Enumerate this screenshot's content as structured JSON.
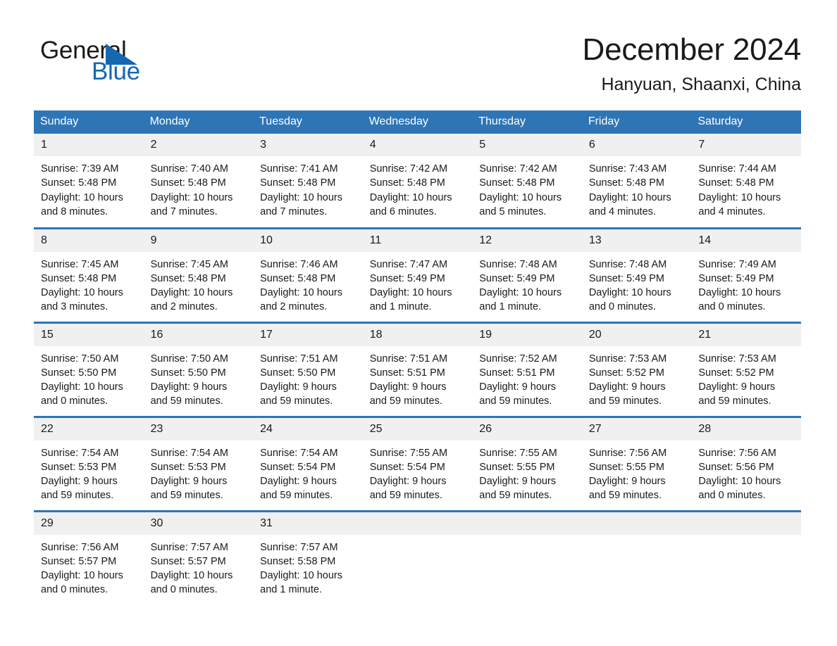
{
  "brand": {
    "name_part1": "General",
    "name_part2": "Blue",
    "accent_color": "#1667b2",
    "triangle_icon": "triangle-icon"
  },
  "header": {
    "title": "December 2024",
    "subtitle": "Hanyuan, Shaanxi, China"
  },
  "theme": {
    "header_blue": "#2e75b6",
    "daynum_band": "#f0f0f0",
    "text": "#1a1a1a"
  },
  "calendar": {
    "weekday_headers": [
      "Sunday",
      "Monday",
      "Tuesday",
      "Wednesday",
      "Thursday",
      "Friday",
      "Saturday"
    ],
    "weeks": [
      [
        {
          "day": "1",
          "sunrise": "Sunrise: 7:39 AM",
          "sunset": "Sunset: 5:48 PM",
          "daylight_line1": "Daylight: 10 hours",
          "daylight_line2": "and 8 minutes."
        },
        {
          "day": "2",
          "sunrise": "Sunrise: 7:40 AM",
          "sunset": "Sunset: 5:48 PM",
          "daylight_line1": "Daylight: 10 hours",
          "daylight_line2": "and 7 minutes."
        },
        {
          "day": "3",
          "sunrise": "Sunrise: 7:41 AM",
          "sunset": "Sunset: 5:48 PM",
          "daylight_line1": "Daylight: 10 hours",
          "daylight_line2": "and 7 minutes."
        },
        {
          "day": "4",
          "sunrise": "Sunrise: 7:42 AM",
          "sunset": "Sunset: 5:48 PM",
          "daylight_line1": "Daylight: 10 hours",
          "daylight_line2": "and 6 minutes."
        },
        {
          "day": "5",
          "sunrise": "Sunrise: 7:42 AM",
          "sunset": "Sunset: 5:48 PM",
          "daylight_line1": "Daylight: 10 hours",
          "daylight_line2": "and 5 minutes."
        },
        {
          "day": "6",
          "sunrise": "Sunrise: 7:43 AM",
          "sunset": "Sunset: 5:48 PM",
          "daylight_line1": "Daylight: 10 hours",
          "daylight_line2": "and 4 minutes."
        },
        {
          "day": "7",
          "sunrise": "Sunrise: 7:44 AM",
          "sunset": "Sunset: 5:48 PM",
          "daylight_line1": "Daylight: 10 hours",
          "daylight_line2": "and 4 minutes."
        }
      ],
      [
        {
          "day": "8",
          "sunrise": "Sunrise: 7:45 AM",
          "sunset": "Sunset: 5:48 PM",
          "daylight_line1": "Daylight: 10 hours",
          "daylight_line2": "and 3 minutes."
        },
        {
          "day": "9",
          "sunrise": "Sunrise: 7:45 AM",
          "sunset": "Sunset: 5:48 PM",
          "daylight_line1": "Daylight: 10 hours",
          "daylight_line2": "and 2 minutes."
        },
        {
          "day": "10",
          "sunrise": "Sunrise: 7:46 AM",
          "sunset": "Sunset: 5:48 PM",
          "daylight_line1": "Daylight: 10 hours",
          "daylight_line2": "and 2 minutes."
        },
        {
          "day": "11",
          "sunrise": "Sunrise: 7:47 AM",
          "sunset": "Sunset: 5:49 PM",
          "daylight_line1": "Daylight: 10 hours",
          "daylight_line2": "and 1 minute."
        },
        {
          "day": "12",
          "sunrise": "Sunrise: 7:48 AM",
          "sunset": "Sunset: 5:49 PM",
          "daylight_line1": "Daylight: 10 hours",
          "daylight_line2": "and 1 minute."
        },
        {
          "day": "13",
          "sunrise": "Sunrise: 7:48 AM",
          "sunset": "Sunset: 5:49 PM",
          "daylight_line1": "Daylight: 10 hours",
          "daylight_line2": "and 0 minutes."
        },
        {
          "day": "14",
          "sunrise": "Sunrise: 7:49 AM",
          "sunset": "Sunset: 5:49 PM",
          "daylight_line1": "Daylight: 10 hours",
          "daylight_line2": "and 0 minutes."
        }
      ],
      [
        {
          "day": "15",
          "sunrise": "Sunrise: 7:50 AM",
          "sunset": "Sunset: 5:50 PM",
          "daylight_line1": "Daylight: 10 hours",
          "daylight_line2": "and 0 minutes."
        },
        {
          "day": "16",
          "sunrise": "Sunrise: 7:50 AM",
          "sunset": "Sunset: 5:50 PM",
          "daylight_line1": "Daylight: 9 hours",
          "daylight_line2": "and 59 minutes."
        },
        {
          "day": "17",
          "sunrise": "Sunrise: 7:51 AM",
          "sunset": "Sunset: 5:50 PM",
          "daylight_line1": "Daylight: 9 hours",
          "daylight_line2": "and 59 minutes."
        },
        {
          "day": "18",
          "sunrise": "Sunrise: 7:51 AM",
          "sunset": "Sunset: 5:51 PM",
          "daylight_line1": "Daylight: 9 hours",
          "daylight_line2": "and 59 minutes."
        },
        {
          "day": "19",
          "sunrise": "Sunrise: 7:52 AM",
          "sunset": "Sunset: 5:51 PM",
          "daylight_line1": "Daylight: 9 hours",
          "daylight_line2": "and 59 minutes."
        },
        {
          "day": "20",
          "sunrise": "Sunrise: 7:53 AM",
          "sunset": "Sunset: 5:52 PM",
          "daylight_line1": "Daylight: 9 hours",
          "daylight_line2": "and 59 minutes."
        },
        {
          "day": "21",
          "sunrise": "Sunrise: 7:53 AM",
          "sunset": "Sunset: 5:52 PM",
          "daylight_line1": "Daylight: 9 hours",
          "daylight_line2": "and 59 minutes."
        }
      ],
      [
        {
          "day": "22",
          "sunrise": "Sunrise: 7:54 AM",
          "sunset": "Sunset: 5:53 PM",
          "daylight_line1": "Daylight: 9 hours",
          "daylight_line2": "and 59 minutes."
        },
        {
          "day": "23",
          "sunrise": "Sunrise: 7:54 AM",
          "sunset": "Sunset: 5:53 PM",
          "daylight_line1": "Daylight: 9 hours",
          "daylight_line2": "and 59 minutes."
        },
        {
          "day": "24",
          "sunrise": "Sunrise: 7:54 AM",
          "sunset": "Sunset: 5:54 PM",
          "daylight_line1": "Daylight: 9 hours",
          "daylight_line2": "and 59 minutes."
        },
        {
          "day": "25",
          "sunrise": "Sunrise: 7:55 AM",
          "sunset": "Sunset: 5:54 PM",
          "daylight_line1": "Daylight: 9 hours",
          "daylight_line2": "and 59 minutes."
        },
        {
          "day": "26",
          "sunrise": "Sunrise: 7:55 AM",
          "sunset": "Sunset: 5:55 PM",
          "daylight_line1": "Daylight: 9 hours",
          "daylight_line2": "and 59 minutes."
        },
        {
          "day": "27",
          "sunrise": "Sunrise: 7:56 AM",
          "sunset": "Sunset: 5:55 PM",
          "daylight_line1": "Daylight: 9 hours",
          "daylight_line2": "and 59 minutes."
        },
        {
          "day": "28",
          "sunrise": "Sunrise: 7:56 AM",
          "sunset": "Sunset: 5:56 PM",
          "daylight_line1": "Daylight: 10 hours",
          "daylight_line2": "and 0 minutes."
        }
      ],
      [
        {
          "day": "29",
          "sunrise": "Sunrise: 7:56 AM",
          "sunset": "Sunset: 5:57 PM",
          "daylight_line1": "Daylight: 10 hours",
          "daylight_line2": "and 0 minutes."
        },
        {
          "day": "30",
          "sunrise": "Sunrise: 7:57 AM",
          "sunset": "Sunset: 5:57 PM",
          "daylight_line1": "Daylight: 10 hours",
          "daylight_line2": "and 0 minutes."
        },
        {
          "day": "31",
          "sunrise": "Sunrise: 7:57 AM",
          "sunset": "Sunset: 5:58 PM",
          "daylight_line1": "Daylight: 10 hours",
          "daylight_line2": "and 1 minute."
        },
        {
          "day": "",
          "sunrise": "",
          "sunset": "",
          "daylight_line1": "",
          "daylight_line2": ""
        },
        {
          "day": "",
          "sunrise": "",
          "sunset": "",
          "daylight_line1": "",
          "daylight_line2": ""
        },
        {
          "day": "",
          "sunrise": "",
          "sunset": "",
          "daylight_line1": "",
          "daylight_line2": ""
        },
        {
          "day": "",
          "sunrise": "",
          "sunset": "",
          "daylight_line1": "",
          "daylight_line2": ""
        }
      ]
    ]
  }
}
